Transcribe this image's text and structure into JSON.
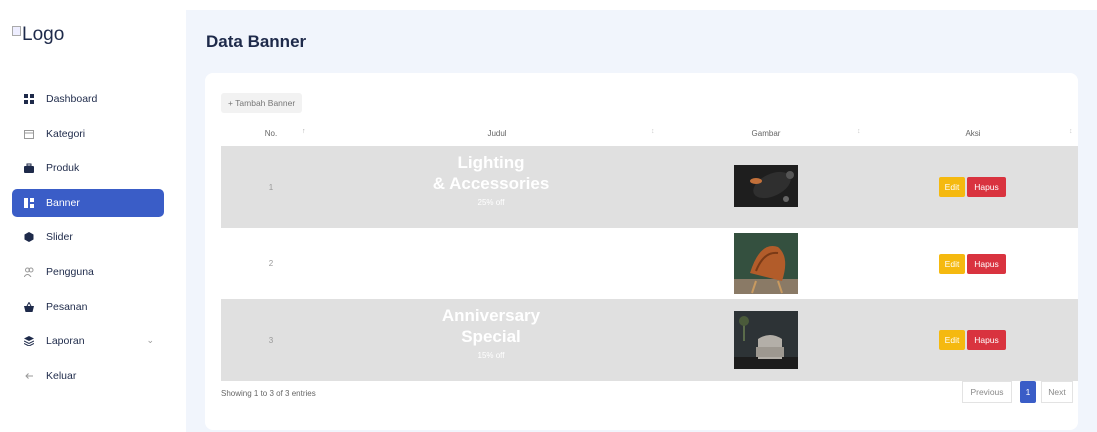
{
  "sidebar": {
    "logo_text": "Logo",
    "items": [
      {
        "label": "Dashboard"
      },
      {
        "label": "Kategori"
      },
      {
        "label": "Produk"
      },
      {
        "label": "Banner"
      },
      {
        "label": "Slider"
      },
      {
        "label": "Pengguna"
      },
      {
        "label": "Pesanan"
      },
      {
        "label": "Laporan"
      },
      {
        "label": "Keluar"
      }
    ]
  },
  "page": {
    "title": "Data Banner"
  },
  "table": {
    "add_label": "+ Tambah Banner",
    "columns": [
      "No.",
      "Judul",
      "Gambar",
      "Aksi"
    ],
    "rows": [
      {
        "no": "1",
        "title_line1": "Lighting",
        "title_line2": "& Accessories",
        "subtitle": "25% off",
        "edit": "Edit",
        "delete": "Hapus"
      },
      {
        "no": "2",
        "title_line1": "",
        "title_line2": "",
        "subtitle": "",
        "edit": "Edit",
        "delete": "Hapus"
      },
      {
        "no": "3",
        "title_line1": "Anniversary",
        "title_line2": "Special",
        "subtitle": "15% off",
        "edit": "Edit",
        "delete": "Hapus"
      }
    ],
    "info": "Showing 1 to 3 of 3 entries",
    "pagination": {
      "previous": "Previous",
      "current": "1",
      "next": "Next"
    }
  },
  "colors": {
    "accent": "#3a5dc7",
    "edit": "#f5b90f",
    "delete": "#d9333f",
    "background": "#f1f5fc"
  }
}
